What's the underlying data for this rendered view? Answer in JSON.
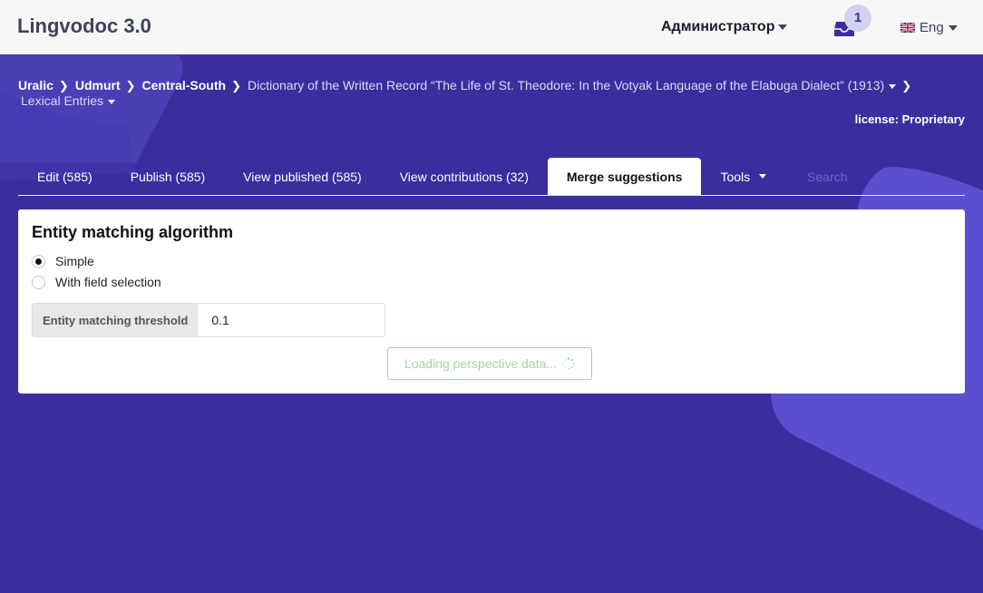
{
  "header": {
    "brand": "Lingvodoc 3.0",
    "user_menu_label": "Администратор",
    "notifications_count": "1",
    "language_label": "Eng"
  },
  "breadcrumb": {
    "items": [
      "Uralic",
      "Udmurt",
      "Central-South"
    ],
    "dictionary": "Dictionary of the Written Record “The Life of St. Theodore: In the Votyak Language of the Elabuga Dialect” (1913)",
    "perspective": "Lexical Entries"
  },
  "license": "license: Proprietary",
  "tabs": [
    {
      "label": "Edit (585)"
    },
    {
      "label": "Publish (585)"
    },
    {
      "label": "View published (585)"
    },
    {
      "label": "View contributions (32)"
    },
    {
      "label": "Merge suggestions"
    },
    {
      "label": "Tools"
    }
  ],
  "search": {
    "placeholder": "Search"
  },
  "panel": {
    "title": "Entity matching algorithm",
    "options": [
      {
        "label": "Simple",
        "checked": true
      },
      {
        "label": "With field selection",
        "checked": false
      }
    ],
    "threshold_label": "Entity matching threshold",
    "threshold_value": "0.1",
    "loading_label": "Loading perspective data..."
  },
  "colors": {
    "background": "#3a2e9e",
    "topbar": "#f7f7f7",
    "loading_accent": "#9ed7a6"
  }
}
